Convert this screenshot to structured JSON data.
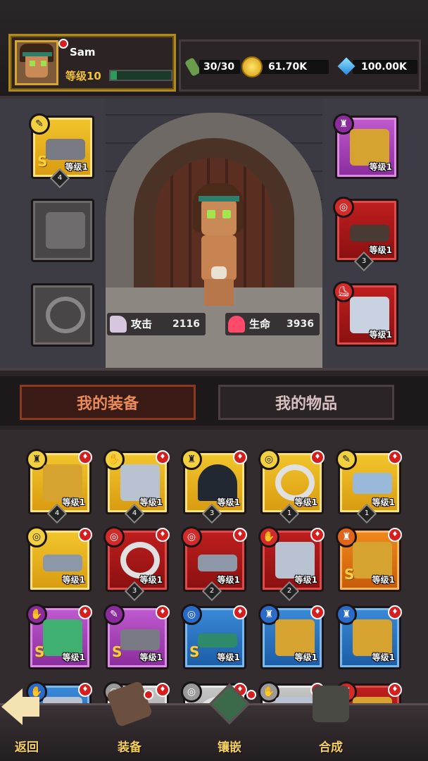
{
  "player": {
    "name": "Sam",
    "level": "等级10",
    "xp_fraction": 0.1
  },
  "resources": {
    "energy": "30/30",
    "gold": "61.70K",
    "gems": "100.00K"
  },
  "stats": {
    "attack_label": "攻击",
    "attack_value": "2116",
    "hp_label": "生命",
    "hp_value": "3936"
  },
  "equipped": {
    "left": [
      {
        "name": "gun",
        "rarity": "gold",
        "level": "等级1",
        "stars": "4",
        "s_rank": "S"
      },
      {
        "name": "empty-glove",
        "rarity": "empty"
      },
      {
        "name": "empty-ring",
        "rarity": "empty"
      }
    ],
    "right": [
      {
        "name": "armor",
        "rarity": "purple",
        "level": "等级1"
      },
      {
        "name": "belt",
        "rarity": "red",
        "level": "等级1",
        "stars": "3"
      },
      {
        "name": "boots",
        "rarity": "red",
        "level": "等级1"
      }
    ]
  },
  "tabs": {
    "equipment": "我的装备",
    "items": "我的物品"
  },
  "inventory": [
    {
      "name": "armor",
      "rarity": "gold",
      "level": "等级1",
      "stars": "4"
    },
    {
      "name": "glove",
      "rarity": "gold",
      "level": "等级1",
      "stars": "4"
    },
    {
      "name": "hood",
      "rarity": "gold",
      "level": "等级1",
      "stars": "3"
    },
    {
      "name": "ring",
      "rarity": "gold",
      "level": "等级1",
      "stars": "1"
    },
    {
      "name": "pistol",
      "rarity": "gold",
      "level": "等级1",
      "stars": "1"
    },
    {
      "name": "belt",
      "rarity": "gold",
      "level": "等级1"
    },
    {
      "name": "ring",
      "rarity": "red",
      "level": "等级1",
      "stars": "3"
    },
    {
      "name": "belt",
      "rarity": "red",
      "level": "等级1",
      "stars": "2"
    },
    {
      "name": "glove",
      "rarity": "red",
      "level": "等级1",
      "stars": "2"
    },
    {
      "name": "armor",
      "rarity": "orange",
      "level": "等级1",
      "s_rank": "S"
    },
    {
      "name": "bracer",
      "rarity": "purple",
      "level": "等级1",
      "s_rank": "S"
    },
    {
      "name": "gun",
      "rarity": "purple",
      "level": "等级1",
      "s_rank": "S"
    },
    {
      "name": "bracelet",
      "rarity": "blue",
      "level": "等级1",
      "s_rank": "S"
    },
    {
      "name": "armor",
      "rarity": "blue",
      "level": "等级1"
    },
    {
      "name": "armor",
      "rarity": "blue",
      "level": "等级1"
    },
    {
      "name": "glove",
      "rarity": "blue",
      "level": ""
    },
    {
      "name": "belt",
      "rarity": "gray",
      "level": ""
    },
    {
      "name": "ring",
      "rarity": "gray",
      "level": ""
    },
    {
      "name": "glove",
      "rarity": "gray",
      "level": ""
    },
    {
      "name": "chest",
      "rarity": "red",
      "level": ""
    }
  ],
  "nav": {
    "back": "返回",
    "equip": "装备",
    "inlay": "镶嵌",
    "merge": "合成"
  },
  "colors": {
    "gold_text": "#f6d060",
    "level_text": "#f2c230",
    "notification": "#d71e1e"
  }
}
